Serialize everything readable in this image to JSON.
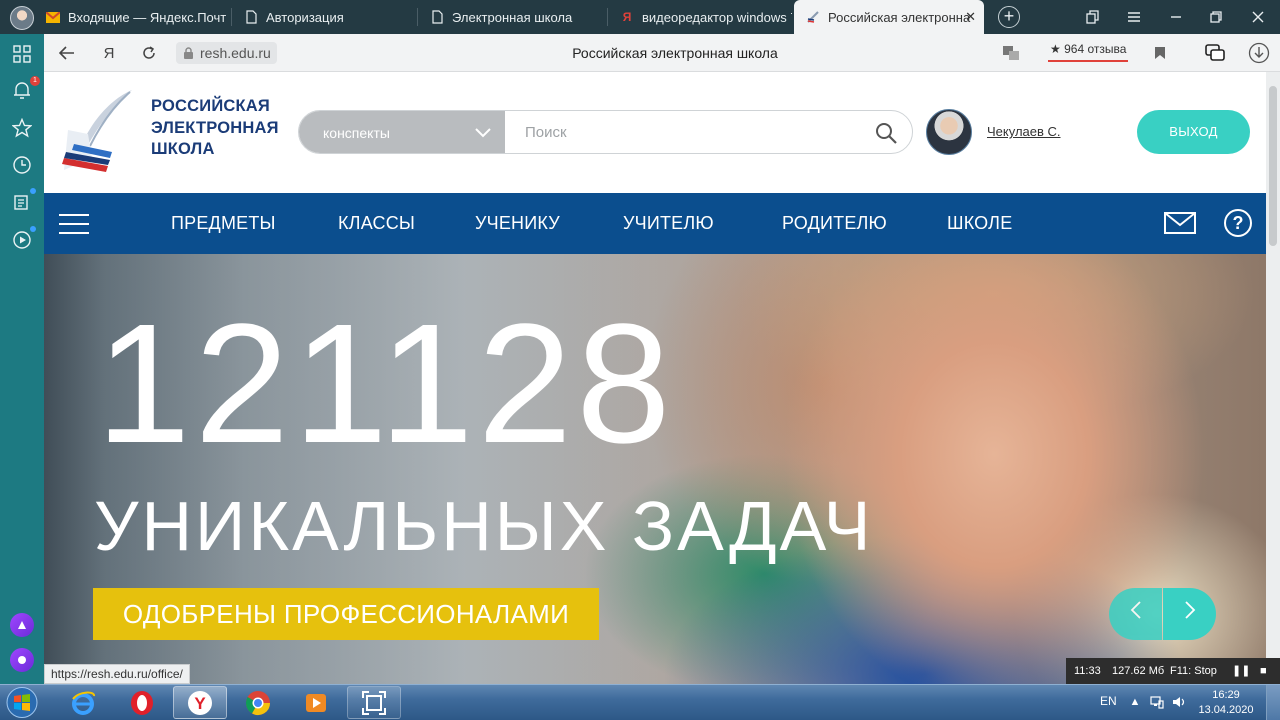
{
  "browser": {
    "tabs": [
      {
        "label": "Входящие — Яндекс.Почт",
        "favicon": "mail-icon"
      },
      {
        "label": "Авторизация",
        "favicon": "page-icon"
      },
      {
        "label": "Электронная школа",
        "favicon": "page-icon"
      },
      {
        "label": "видеоредактор windows 7",
        "favicon": "yandex-icon"
      },
      {
        "label": "Российская электронна",
        "favicon": "resh-icon",
        "active": true
      }
    ],
    "new_tab": "+",
    "address": {
      "url": "resh.edu.ru",
      "page_title": "Российская электронная школа",
      "reviews": "★ 964 отзыва"
    },
    "notification_count": "1",
    "status_link": "https://resh.edu.ru/office/"
  },
  "site": {
    "logo_lines": [
      "РОССИЙСКАЯ",
      "ЭЛЕКТРОННАЯ",
      "ШКОЛА"
    ],
    "search": {
      "category": "конспекты",
      "placeholder": "Поиск"
    },
    "user_name": "Чекулаев С.",
    "logout": "выход",
    "nav": [
      "ПРЕДМЕТЫ",
      "КЛАССЫ",
      "УЧЕНИКУ",
      "УЧИТЕЛЮ",
      "РОДИТЕЛЮ",
      "ШКОЛЕ"
    ],
    "hero": {
      "count": "121128",
      "title": "УНИКАЛЬНЫХ ЗАДАЧ",
      "badge": "ОДОБРЕНЫ ПРОФЕССИОНАЛАМИ"
    }
  },
  "recorder": {
    "time": "11:33",
    "size": "127.62 Мб",
    "hint": "F11: Stop"
  },
  "taskbar": {
    "lang": "EN",
    "time": "16:29",
    "date": "13.04.2020"
  },
  "colors": {
    "brand_blue": "#0b4e8e",
    "accent_teal": "#39d0c3",
    "badge_yellow": "#e6c10d"
  }
}
